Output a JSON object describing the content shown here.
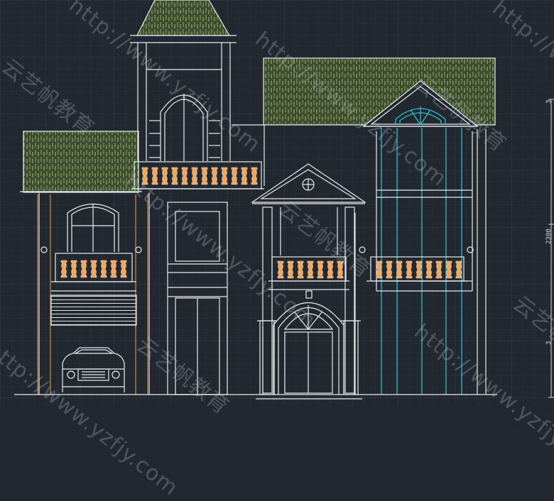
{
  "viewport": {
    "background": "#212830",
    "grid_minor": "#2b3440",
    "grid_major": "#344050",
    "colors": {
      "lines": "#e9ecef",
      "roof_fill": "#3c4d2f",
      "roof_hatch": "#8fa86a",
      "railing": "#f0a860",
      "ladder": "#d48a3c",
      "glazing": "#2fc7d4"
    }
  },
  "watermarks": {
    "url": "http://www.yzfjy.com",
    "brand": "云艺帆教育"
  },
  "rulers": {
    "right_top": "3",
    "right_mid": "2300",
    "right_bottom": "3"
  }
}
